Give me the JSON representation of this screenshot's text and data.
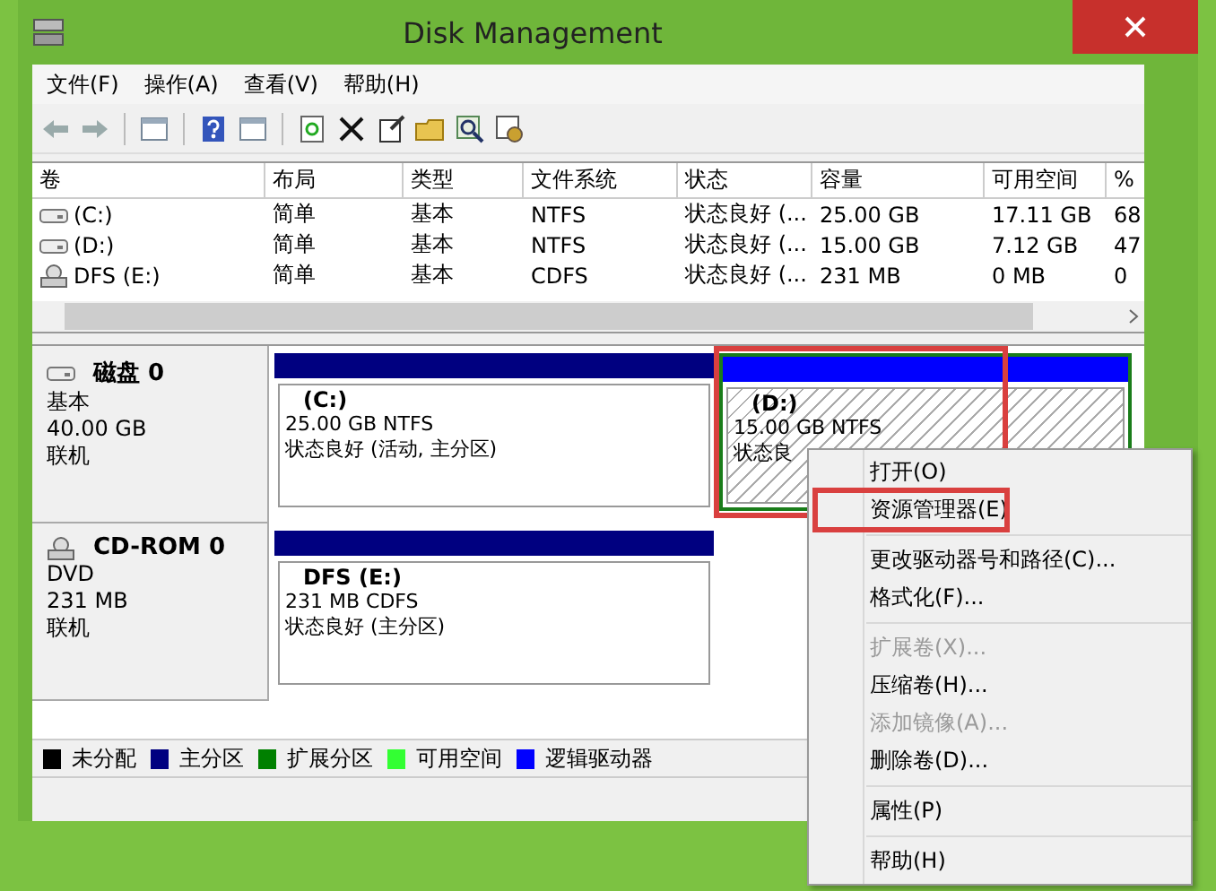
{
  "window": {
    "title": "Disk Management"
  },
  "menu_bar": [
    "文件(F)",
    "操作(A)",
    "查看(V)",
    "帮助(H)"
  ],
  "volumes": {
    "columns": [
      "卷",
      "布局",
      "类型",
      "文件系统",
      "状态",
      "容量",
      "可用空间",
      "%"
    ],
    "rows": [
      {
        "kind": "hdd",
        "cells": [
          "(C:)",
          "简单",
          "基本",
          "NTFS",
          "状态良好 (...",
          "25.00 GB",
          "17.11 GB",
          "68"
        ]
      },
      {
        "kind": "hdd",
        "cells": [
          "(D:)",
          "简单",
          "基本",
          "NTFS",
          "状态良好 (...",
          "15.00 GB",
          "7.12 GB",
          "47"
        ]
      },
      {
        "kind": "cd",
        "cells": [
          "DFS (E:)",
          "简单",
          "基本",
          "CDFS",
          "状态良好 (...",
          "231 MB",
          "0 MB",
          "0"
        ]
      }
    ]
  },
  "disks": [
    {
      "kind": "hdd",
      "name": "磁盘 0",
      "lines": [
        "基本",
        "40.00 GB",
        "联机"
      ],
      "partitions": [
        {
          "kind": "primary",
          "name": "(C:)",
          "lines": [
            "25.00 GB NTFS",
            "状态良好 (活动, 主分区)"
          ],
          "highlighted": false
        },
        {
          "kind": "logical",
          "name": "(D:)",
          "lines": [
            "15.00 GB NTFS",
            "状态良"
          ],
          "highlighted": true
        }
      ]
    },
    {
      "kind": "cd",
      "name": "CD-ROM 0",
      "lines": [
        "DVD",
        "231 MB",
        "联机"
      ],
      "partitions": [
        {
          "kind": "primary",
          "name": "DFS  (E:)",
          "lines": [
            "231 MB CDFS",
            "状态良好 (主分区)"
          ],
          "highlighted": false
        }
      ]
    }
  ],
  "legend": [
    {
      "label": "未分配",
      "color": "#000000"
    },
    {
      "label": "主分区",
      "color": "#000080"
    },
    {
      "label": "扩展分区",
      "color": "#008000"
    },
    {
      "label": "可用空间",
      "color": "#33ff33"
    },
    {
      "label": "逻辑驱动器",
      "color": "#0000ff"
    }
  ],
  "context_menu": {
    "groups": [
      [
        {
          "label": "打开(O)",
          "disabled": false
        },
        {
          "label": "资源管理器(E)",
          "disabled": false,
          "highlighted": true
        }
      ],
      [
        {
          "label": "更改驱动器号和路径(C)...",
          "disabled": false
        },
        {
          "label": "格式化(F)...",
          "disabled": false
        }
      ],
      [
        {
          "label": "扩展卷(X)...",
          "disabled": true
        },
        {
          "label": "压缩卷(H)...",
          "disabled": false
        },
        {
          "label": "添加镜像(A)...",
          "disabled": true
        },
        {
          "label": "删除卷(D)...",
          "disabled": false
        }
      ],
      [
        {
          "label": "属性(P)",
          "disabled": false
        }
      ],
      [
        {
          "label": "帮助(H)",
          "disabled": false
        }
      ]
    ]
  }
}
